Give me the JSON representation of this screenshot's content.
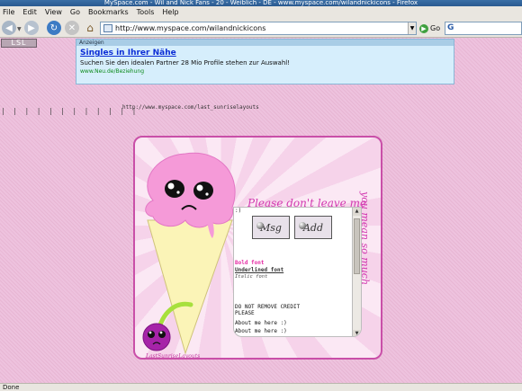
{
  "window": {
    "title": "MySpace.com - Wil and Nick Fans - 20 - Weiblich - DE - www.myspace.com/wilandnickicons - Firefox"
  },
  "menu": [
    "File",
    "Edit",
    "View",
    "Go",
    "Bookmarks",
    "Tools",
    "Help"
  ],
  "navbar": {
    "url": "http://www.myspace.com/wilandnickicons",
    "go_label": "Go"
  },
  "page": {
    "badge": "LSL",
    "ad": {
      "label": "Anzeigen",
      "title": "Singles in Ihrer Nähe",
      "text": "Suchen Sie den idealen Partner 28 Mio Profile stehen zur Auswahl!",
      "url": "www.Neu.de/Beziehung"
    },
    "bars": "| | | | | | | | | | | |",
    "credit_url": "http://www.myspace.com/last_sunriselayouts",
    "layout": {
      "heading": "Please don't leave me",
      "vertical_text": "you mean so much",
      "signature": "LastSunriseLayouts",
      "panel": {
        "smile": ":)",
        "msg_button": "Msg",
        "add_button": "Add",
        "bold_font": "Bold font",
        "underlined_font": "Underlined font",
        "italic_font": "Italic font",
        "notice_line1": "DO NOT REMOVE CREDIT",
        "notice_line2": "PLEASE",
        "about1": "About me here :)",
        "about2": "About me here :)"
      }
    }
  },
  "status": "Done"
}
